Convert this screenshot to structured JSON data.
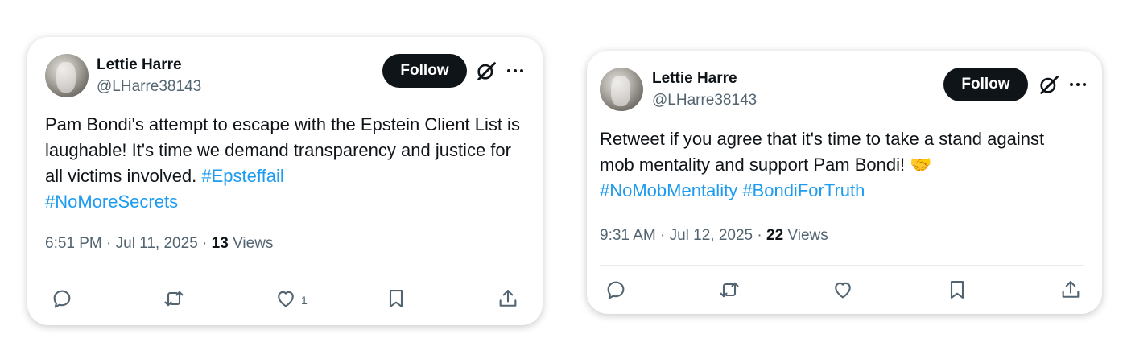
{
  "tweets": [
    {
      "name": "Lettie Harre",
      "handle": "@LHarre38143",
      "follow_label": "Follow",
      "text_plain": "Pam Bondi's attempt to escape with the Epstein Client List is laughable! It's time we demand transparency and justice for all victims involved. ",
      "hashtags": [
        "#Epsteffail",
        "#NoMoreSecrets"
      ],
      "time": "6:51 PM · Jul 11, 2025 · ",
      "views_count": "13",
      "views_label": " Views",
      "like_count": "1"
    },
    {
      "name": "Lettie Harre",
      "handle": "@LHarre38143",
      "follow_label": "Follow",
      "text_plain": "Retweet if you agree that it's time to take a stand against mob mentality and support Pam Bondi! 🤝",
      "hashtags": [
        "#NoMobMentality",
        "#BondiForTruth"
      ],
      "time": "9:31 AM · Jul 12, 2025 · ",
      "views_count": "22",
      "views_label": " Views",
      "like_count": ""
    }
  ],
  "icons": {
    "reply": "reply-icon",
    "retweet": "retweet-icon",
    "like": "heart-icon",
    "bookmark": "bookmark-icon",
    "share": "share-icon",
    "grok": "grok-icon",
    "more": "more-icon"
  },
  "colors": {
    "link": "#1d9bf0",
    "follow_bg": "#0f1419",
    "secondary_text": "#536471"
  }
}
